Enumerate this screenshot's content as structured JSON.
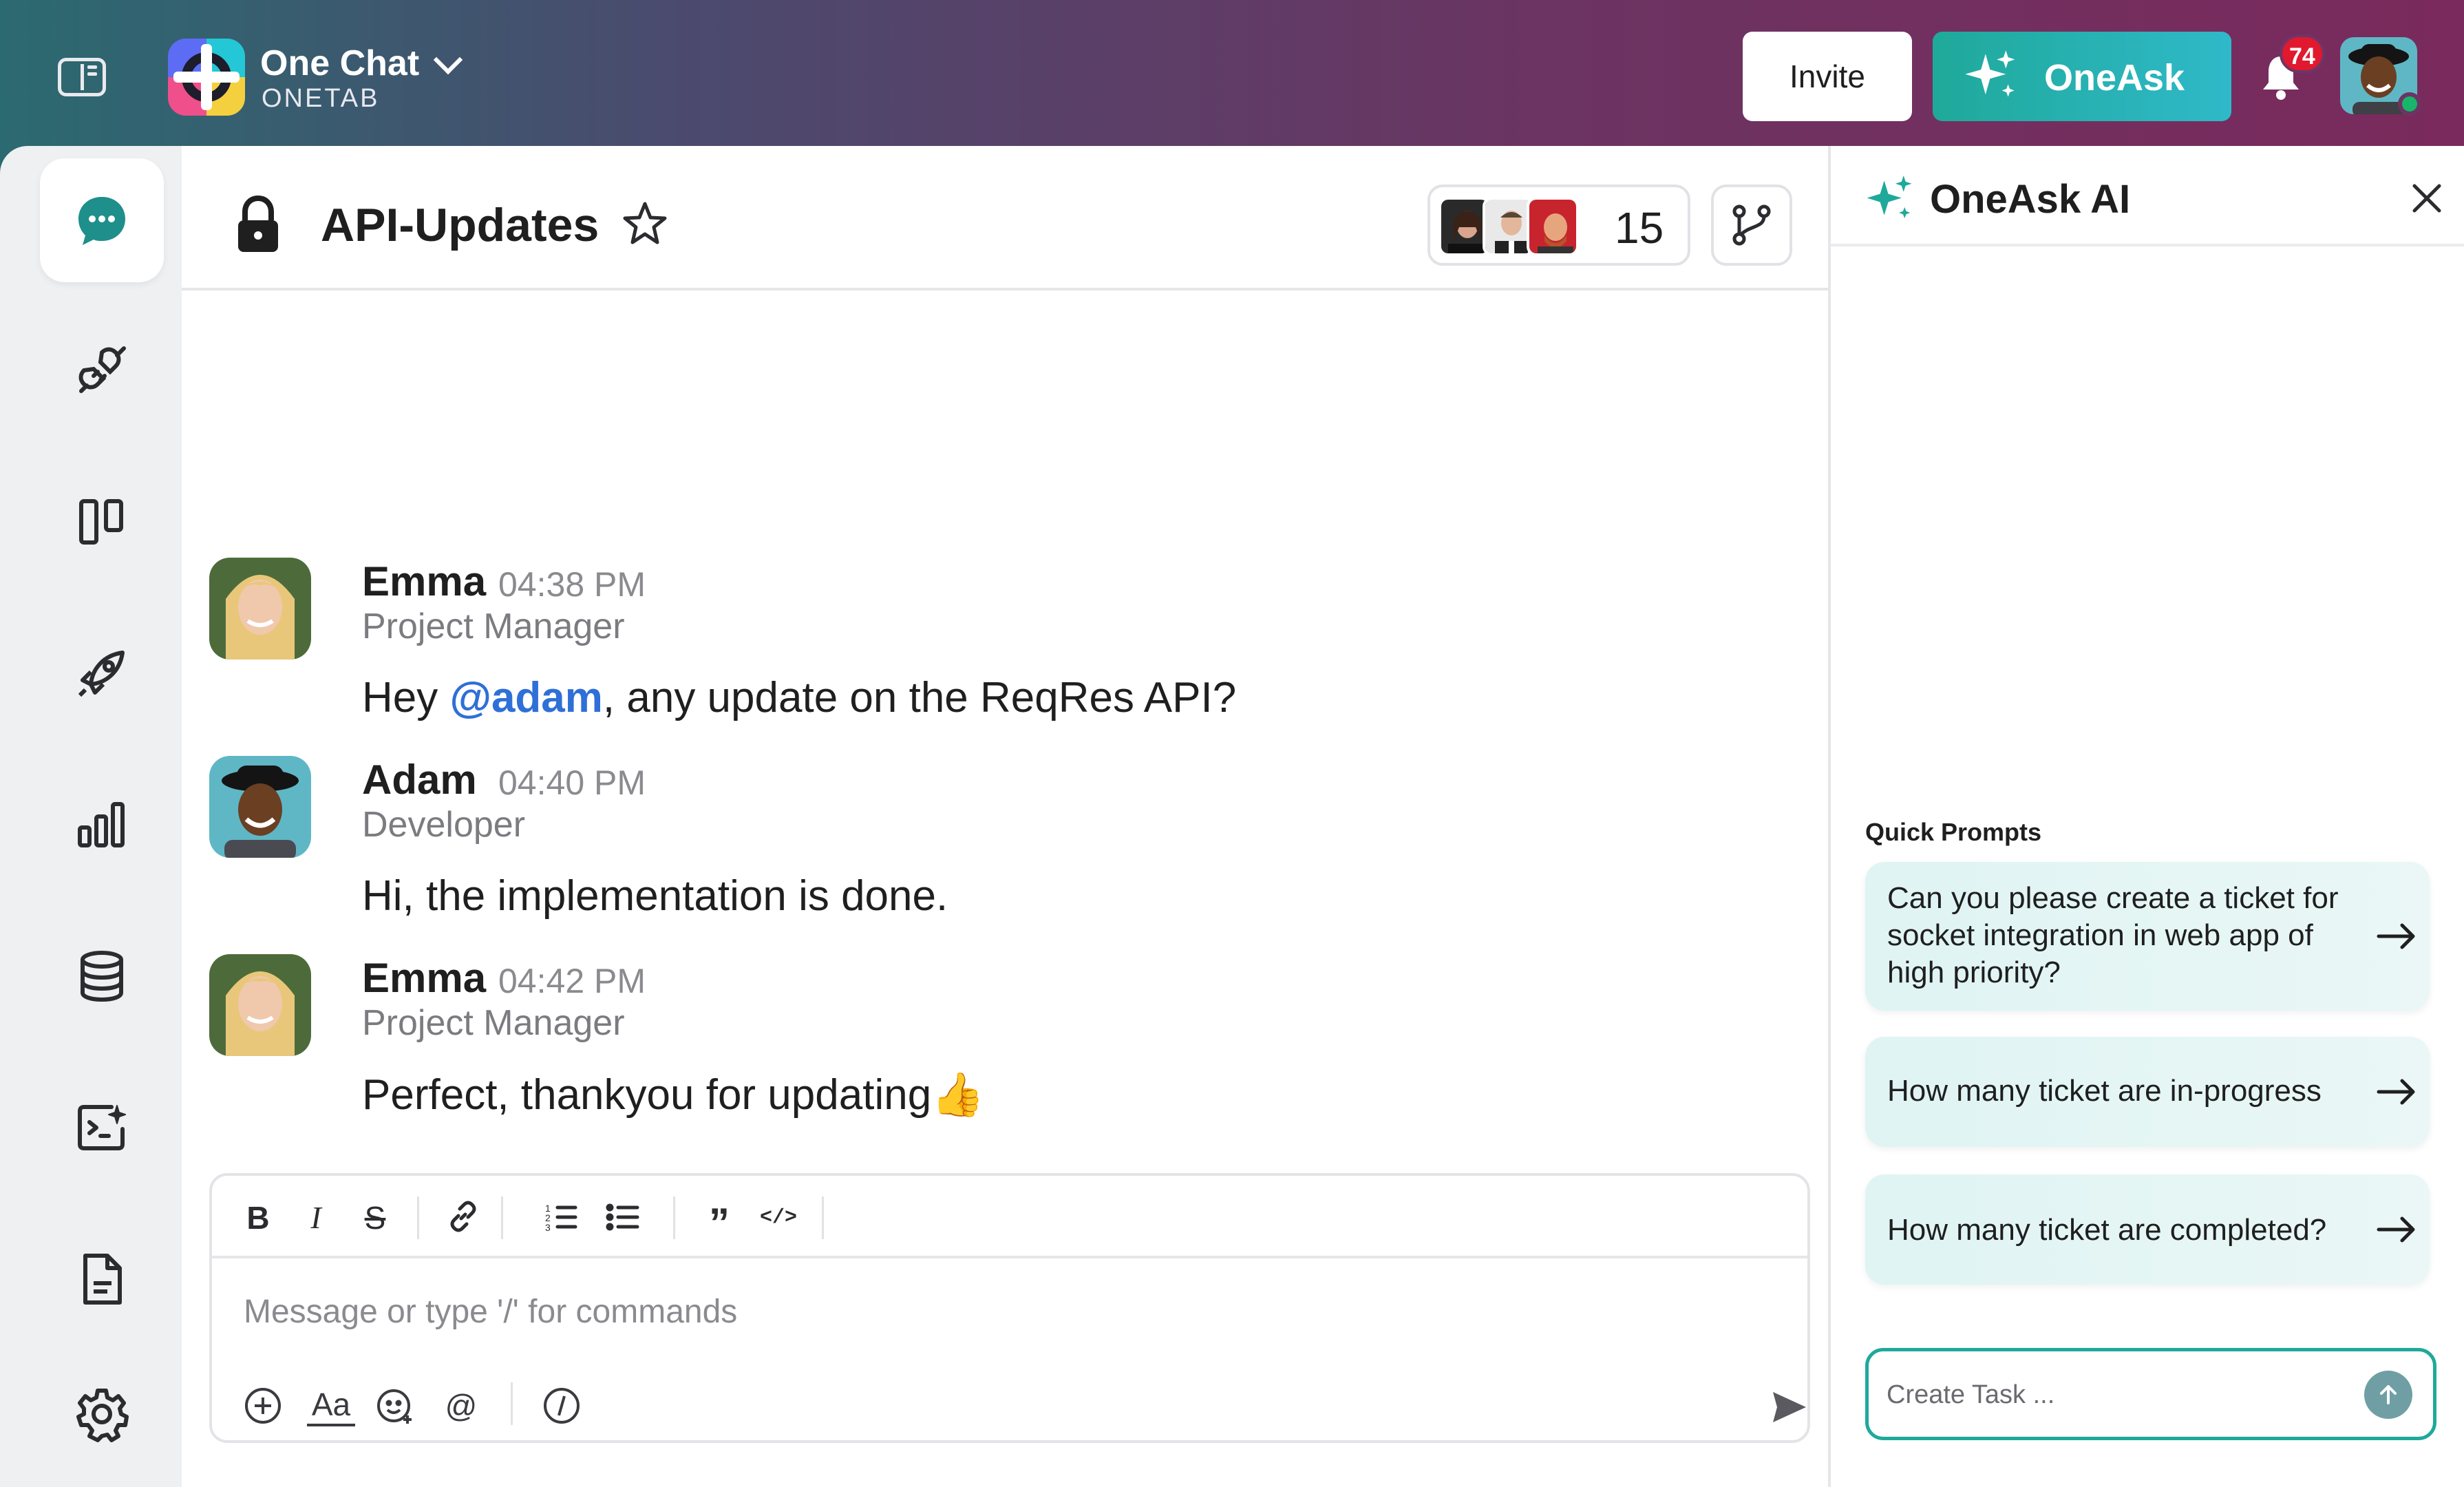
{
  "workspace": {
    "name": "One Chat",
    "subtitle": "ONETAB"
  },
  "topbar": {
    "invite_label": "Invite",
    "oneask_label": "OneAsk",
    "notification_count": "74",
    "icons": [
      "sidebar-toggle-icon",
      "chevron-down-icon",
      "sparkle-icon",
      "bell-icon"
    ]
  },
  "nav": {
    "items": [
      {
        "icon": "chat-bubble-icon",
        "active": true
      },
      {
        "icon": "plug-icon"
      },
      {
        "icon": "board-icon"
      },
      {
        "icon": "rocket-icon"
      },
      {
        "icon": "bar-chart-icon"
      },
      {
        "icon": "database-icon"
      },
      {
        "icon": "terminal-sparkle-icon"
      },
      {
        "icon": "document-icon"
      },
      {
        "icon": "gear-icon"
      }
    ]
  },
  "channel": {
    "title": "API-Updates",
    "member_count": "15"
  },
  "messages": [
    {
      "author": "Emma",
      "time": "04:38 PM",
      "role": "Project Manager",
      "text_before": "Hey ",
      "mention": "@adam",
      "text_after": ", any update on the ReqRes API?"
    },
    {
      "author": "Adam",
      "time": "04:40 PM",
      "role": "Developer",
      "text": "Hi, the implementation is done."
    },
    {
      "author": "Emma",
      "time": "04:42 PM",
      "role": "Project Manager",
      "text": "Perfect, thankyou for updating👍"
    }
  ],
  "composer": {
    "placeholder": "Message or type '/' for commands",
    "toolbar": [
      "B",
      "I",
      "S",
      "link",
      "ordered-list",
      "bullet-list",
      "quote",
      "code"
    ],
    "text_style_label": "Aa",
    "mention_label": "@"
  },
  "panel": {
    "title": "OneAsk AI",
    "quick_prompts_label": "Quick Prompts",
    "prompts": [
      "Can you please create a ticket for socket integration in web app of high priority?",
      "How many ticket are in-progress",
      "How many ticket are completed?"
    ],
    "task_placeholder": "Create Task ..."
  },
  "colors": {
    "accent": "#1fa99a",
    "mention": "#2f6fd8",
    "badge": "#e0192f",
    "online": "#19b56a"
  }
}
